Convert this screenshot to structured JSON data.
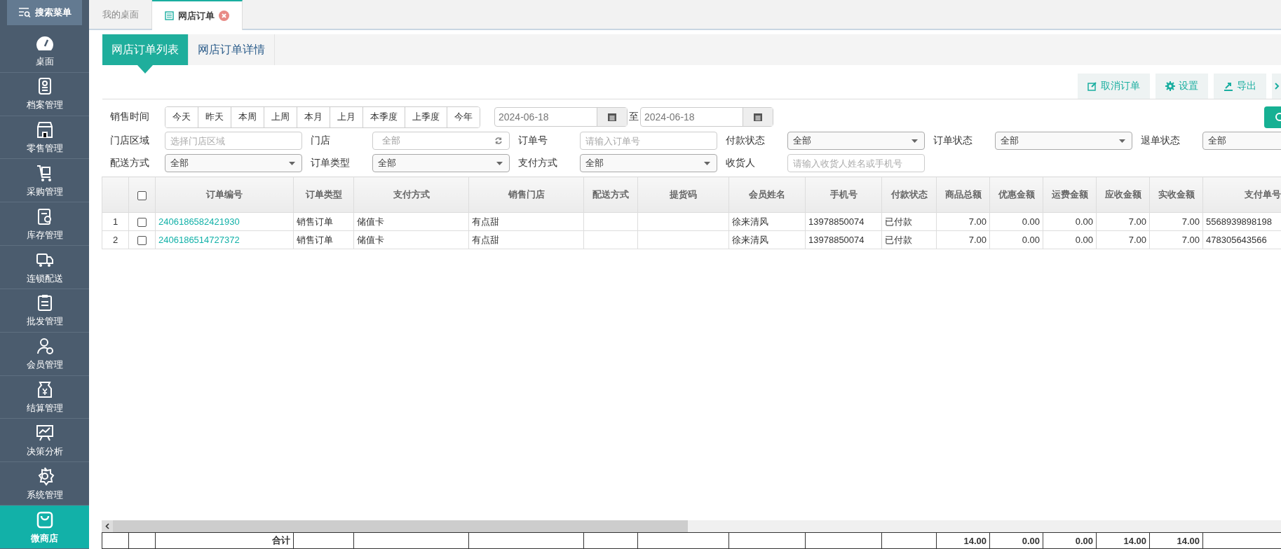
{
  "sidebar": {
    "search_button": "搜索菜单",
    "items": [
      {
        "label": "桌面",
        "selected": false
      },
      {
        "label": "档案管理",
        "selected": false
      },
      {
        "label": "零售管理",
        "selected": false
      },
      {
        "label": "采购管理",
        "selected": false
      },
      {
        "label": "库存管理",
        "selected": false
      },
      {
        "label": "连锁配送",
        "selected": false
      },
      {
        "label": "批发管理",
        "selected": false
      },
      {
        "label": "会员管理",
        "selected": false
      },
      {
        "label": "结算管理",
        "selected": false
      },
      {
        "label": "决策分析",
        "selected": false
      },
      {
        "label": "系统管理",
        "selected": false
      },
      {
        "label": "微商店",
        "selected": true
      }
    ]
  },
  "tabs": [
    {
      "label": "我的桌面",
      "selected": false,
      "closable": false
    },
    {
      "label": "网店订单",
      "selected": true,
      "closable": true
    }
  ],
  "sub_tabs": [
    {
      "label": "网店订单列表",
      "selected": true
    },
    {
      "label": "网店订单详情",
      "selected": false
    }
  ],
  "toolbar": [
    {
      "label": "取消订单",
      "kind": "edit"
    },
    {
      "label": "设置",
      "kind": "gear"
    },
    {
      "label": "导出",
      "kind": "export"
    }
  ],
  "filters": {
    "sale_time": {
      "label": "销售时间",
      "quick": [
        "今天",
        "昨天",
        "本周",
        "上周",
        "本月",
        "上月",
        "本季度",
        "上季度",
        "今年"
      ],
      "from": "2024-06-18",
      "to_label": "至",
      "to": "2024-06-18"
    },
    "row2": [
      {
        "label": "门店区域",
        "kind": "text",
        "placeholder": "选择门店区域"
      },
      {
        "label": "门店",
        "kind": "refresh",
        "placeholder": "全部"
      },
      {
        "label": "订单号",
        "kind": "text",
        "placeholder": "请输入订单号"
      },
      {
        "label": "付款状态",
        "kind": "select",
        "value": "全部"
      },
      {
        "label": "订单状态",
        "kind": "select",
        "value": "全部"
      },
      {
        "label": "退单状态",
        "kind": "select",
        "value": "全部"
      }
    ],
    "row3": [
      {
        "label": "配送方式",
        "kind": "select",
        "value": "全部"
      },
      {
        "label": "订单类型",
        "kind": "select",
        "value": "全部"
      },
      {
        "label": "支付方式",
        "kind": "select",
        "value": "全部"
      },
      {
        "label": "收货人",
        "kind": "text",
        "placeholder": "请输入收货人姓名或手机号"
      }
    ]
  },
  "table": {
    "select_all_checked": false,
    "columns": [
      "订单编号",
      "订单类型",
      "支付方式",
      "销售门店",
      "配送方式",
      "提货码",
      "会员姓名",
      "手机号",
      "付款状态",
      "商品总额",
      "优惠金额",
      "运费金额",
      "应收金额",
      "实收金额",
      "支付单号"
    ],
    "rows": [
      {
        "index": "1",
        "checked": false,
        "order_no": "2406186582421930",
        "order_type": "销售订单",
        "payment": "储值卡",
        "store": "有点甜",
        "member": "徐来清风",
        "phone": "13978850074",
        "pay_status": "已付款",
        "goods_total": "7.00",
        "discount": "0.00",
        "freight": "0.00",
        "receivable": "7.00",
        "received": "7.00",
        "pay_no": "5568939898198"
      },
      {
        "index": "2",
        "checked": false,
        "order_no": "2406186514727372",
        "order_type": "销售订单",
        "payment": "储值卡",
        "store": "有点甜",
        "member": "徐来清风",
        "phone": "13978850074",
        "pay_status": "已付款",
        "goods_total": "7.00",
        "discount": "0.00",
        "freight": "0.00",
        "receivable": "7.00",
        "received": "7.00",
        "pay_no": "478305643566"
      }
    ],
    "footer": {
      "label": "合计",
      "amounts": [
        "14.00",
        "0.00",
        "0.00",
        "14.00",
        "14.00"
      ]
    }
  }
}
